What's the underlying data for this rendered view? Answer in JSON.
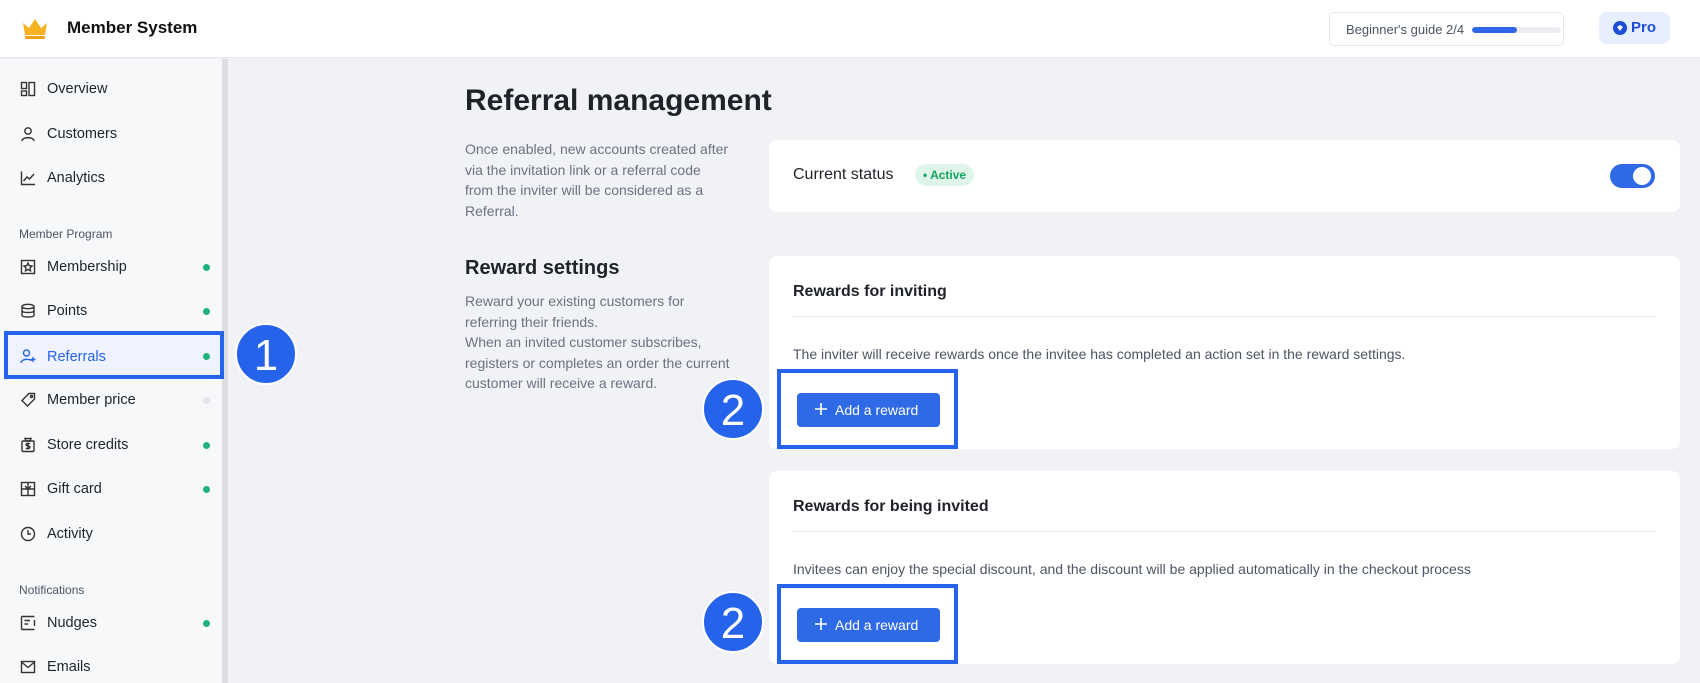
{
  "header": {
    "app_title": "Member System",
    "logo_icon": "crown-icon",
    "guide_label": "Beginner's guide 2/4",
    "guide_progress": 0.5,
    "plan_label": "Pro"
  },
  "sidebar": {
    "top_items": [
      {
        "label": "Overview",
        "icon": "dashboard-icon"
      },
      {
        "label": "Customers",
        "icon": "person-icon"
      },
      {
        "label": "Analytics",
        "icon": "line-chart-icon"
      }
    ],
    "section_member_program": "Member Program",
    "program_items": [
      {
        "label": "Membership",
        "icon": "badge-icon",
        "status": "enabled"
      },
      {
        "label": "Points",
        "icon": "database-icon",
        "status": "enabled"
      },
      {
        "label": "Referrals",
        "icon": "add-user-icon",
        "status": "enabled",
        "active": true
      },
      {
        "label": "Member price",
        "icon": "tag-icon",
        "status": "disabled"
      },
      {
        "label": "Store credits",
        "icon": "dollar-bag-icon",
        "status": "enabled"
      },
      {
        "label": "Gift card",
        "icon": "gift-card-icon",
        "status": "enabled"
      },
      {
        "label": "Activity",
        "icon": "clock-icon"
      }
    ],
    "section_notifications": "Notifications",
    "notification_items": [
      {
        "label": "Nudges",
        "icon": "nudge-icon",
        "status": "enabled"
      },
      {
        "label": "Emails",
        "icon": "mail-icon"
      }
    ]
  },
  "steps": {
    "one": "1",
    "two": "2"
  },
  "main": {
    "title": "Referral management",
    "intro_lines": [
      "Once enabled, new accounts created after",
      "via the invitation link or a referral code",
      "from the inviter will be considered as a",
      "Referral."
    ],
    "status": {
      "label": "Current status",
      "badge": "• Active",
      "enabled": true
    },
    "reward_settings": {
      "title": "Reward settings",
      "lines": [
        "Reward your existing customers for",
        "referring their friends.",
        "When an invited customer subscribes,",
        "registers or completes an order the current",
        "customer will receive a reward."
      ]
    },
    "cards": [
      {
        "title": "Rewards for inviting",
        "text": "The inviter will receive rewards once the invitee has completed an action set in the reward settings.",
        "button": "Add a reward"
      },
      {
        "title": "Rewards for being invited",
        "text": "Invitees can enjoy the special discount, and the discount will be applied automatically in the checkout process",
        "button": "Add a reward"
      }
    ]
  },
  "colors": {
    "accent": "#2563eb",
    "active_dot": "#22b07d",
    "active_badge_bg": "#dff5ea"
  }
}
